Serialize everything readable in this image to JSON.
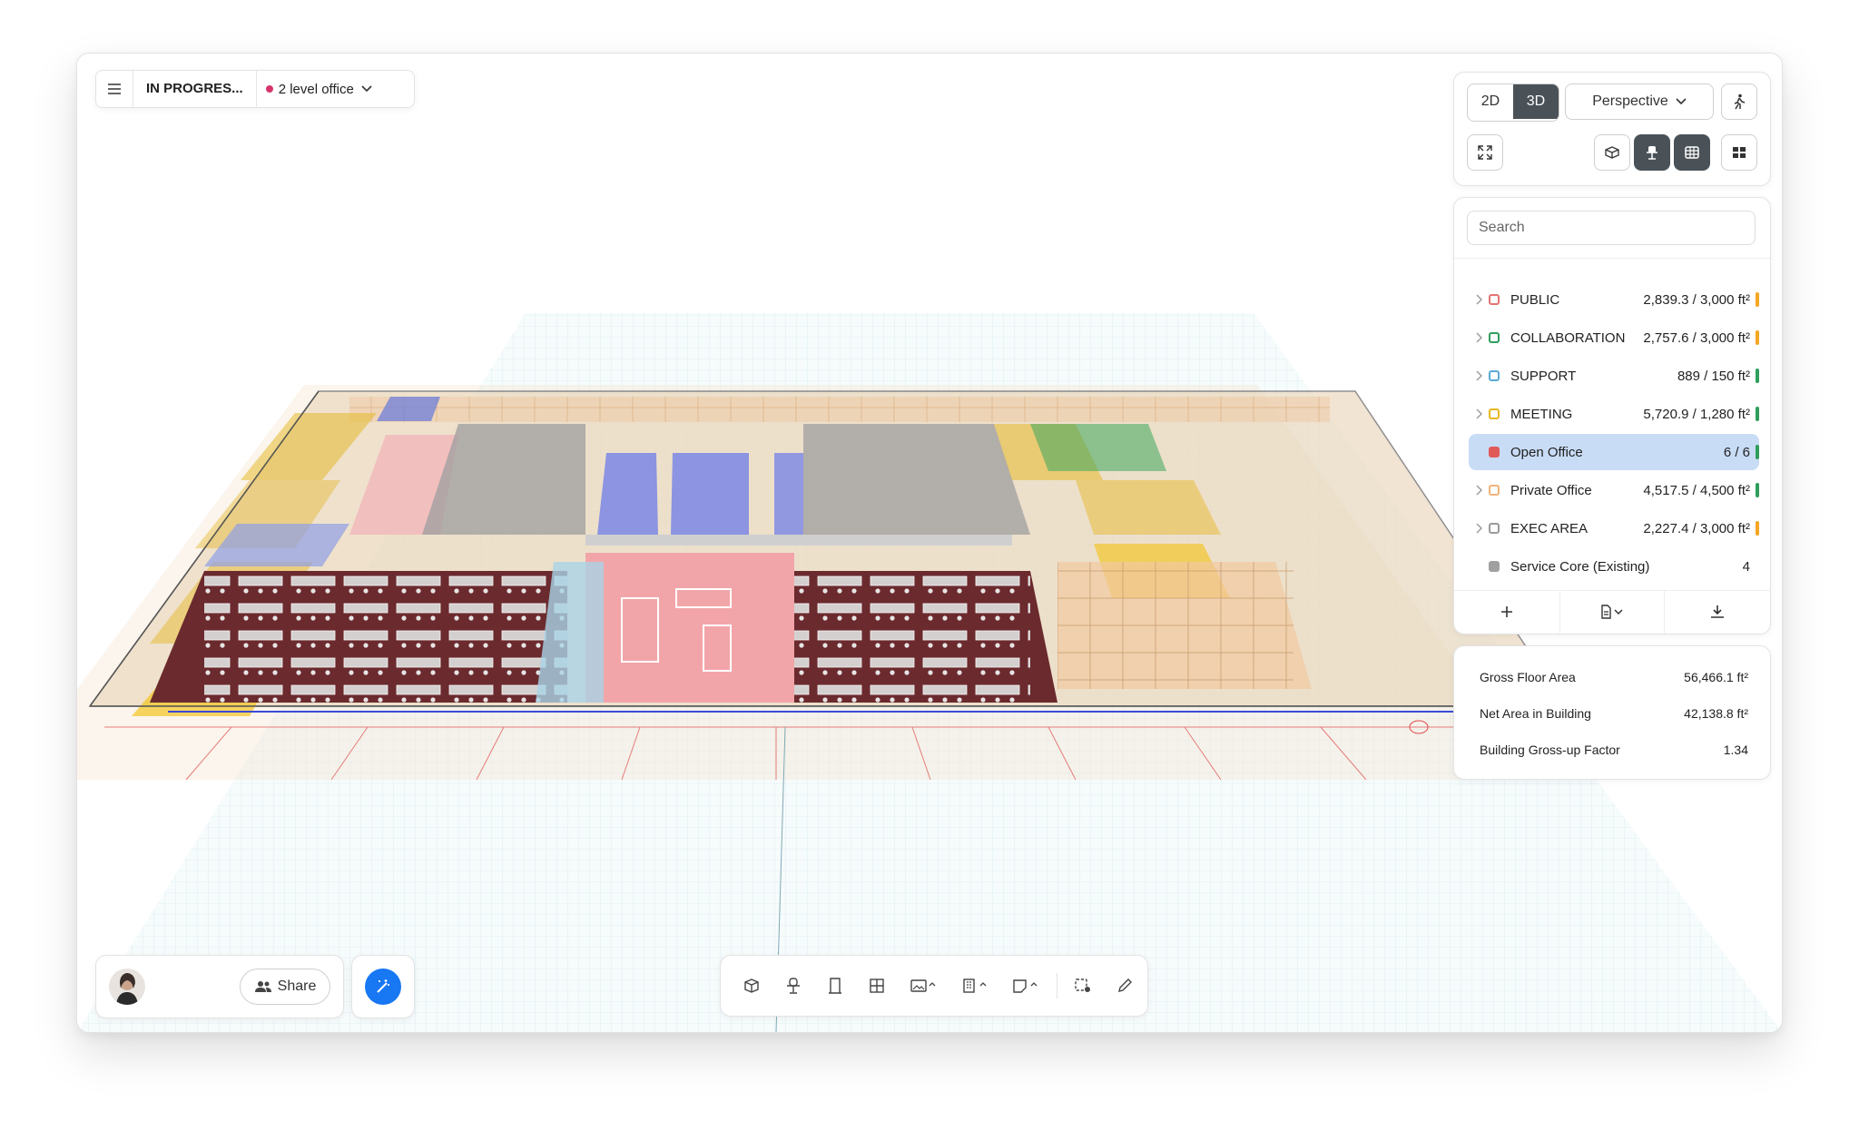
{
  "topbar": {
    "status": "IN PROGRES...",
    "project_name": "2 level office",
    "status_dot_color": "#d6336c",
    "menu_icon": "hamburger-menu-icon",
    "dropdown_icon": "chevron-down-icon"
  },
  "view_controls": {
    "mode_2d": "2D",
    "mode_3d": "3D",
    "active_mode": "3D",
    "camera": "Perspective",
    "walk_icon": "walking-person-icon",
    "fit_icon": "fit-to-screen-icon",
    "layer_icons": [
      "box-layer-icon",
      "furniture-layer-icon",
      "grid-layer-icon",
      "dashboard-layer-icon"
    ]
  },
  "program": {
    "search_placeholder": "Search",
    "categories": [
      {
        "name": "PUBLIC",
        "value": "2,839.3 / 3,000 ft²",
        "swatch": "#e57373",
        "filled": false,
        "bar": "#f5a623",
        "expandable": true
      },
      {
        "name": "COLLABORATION",
        "value": "2,757.6 / 3,000 ft²",
        "swatch": "#2e9e5b",
        "filled": false,
        "bar": "#f5a623",
        "expandable": true
      },
      {
        "name": "SUPPORT",
        "value": "889 / 150 ft²",
        "swatch": "#5aa9d6",
        "filled": false,
        "bar": "#2e9e5b",
        "expandable": true
      },
      {
        "name": "MEETING",
        "value": "5,720.9 / 1,280 ft²",
        "swatch": "#e9b820",
        "filled": false,
        "bar": "#2e9e5b",
        "expandable": true
      },
      {
        "name": "Open Office",
        "value": "6 / 6",
        "swatch": "#e05a5a",
        "filled": true,
        "bar": "#2e9e5b",
        "expandable": false,
        "selected": true
      },
      {
        "name": "Private Office",
        "value": "4,517.5 / 4,500 ft²",
        "swatch": "#f3b37a",
        "filled": false,
        "bar": "#2e9e5b",
        "expandable": true
      },
      {
        "name": "EXEC AREA",
        "value": "2,227.4 / 3,000 ft²",
        "swatch": "#9a9a9a",
        "filled": false,
        "bar": "#f5a623",
        "expandable": true
      },
      {
        "name": "Service Core (Existing)",
        "value": "4",
        "swatch": "#a0a0a0",
        "filled": true,
        "bar": null,
        "expandable": false
      }
    ],
    "footer_icons": [
      "add-icon",
      "document-dropdown-icon",
      "download-icon"
    ]
  },
  "stats": [
    {
      "label": "Gross Floor Area",
      "value": "56,466.1 ft²"
    },
    {
      "label": "Net Area in Building",
      "value": "42,138.8 ft²"
    },
    {
      "label": "Building Gross-up Factor",
      "value": "1.34"
    }
  ],
  "bottom_left": {
    "share_label": "Share",
    "avatar_icon": "user-avatar",
    "magic_icon": "magic-wand-icon",
    "accent": "#1877f2"
  },
  "toolbar": {
    "tools": [
      "cube-icon",
      "desk-chair-icon",
      "door-icon",
      "window-grid-icon",
      "image-icon",
      "building-icon",
      "sticky-note-icon",
      "selection-icon",
      "pencil-icon"
    ]
  },
  "colors": {
    "open_office_floor": "#6b2a2e",
    "meeting": "#e5b92e",
    "private_office": "#f1c9a0",
    "public_pink": "#f2b6bc",
    "support_blue": "#8fa0e6",
    "service_core": "#a3a3a3"
  }
}
